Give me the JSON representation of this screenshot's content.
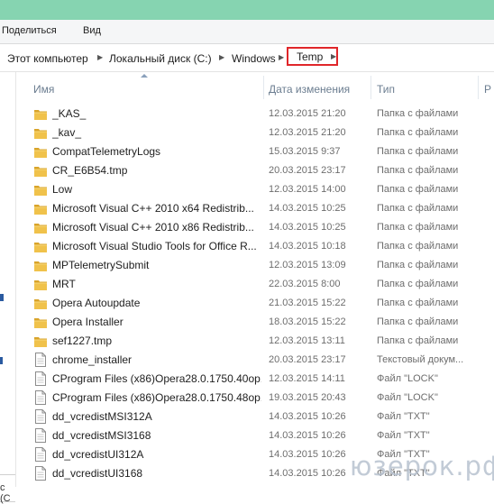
{
  "ribbon": {
    "tabs": [
      "Поделиться",
      "Вид"
    ]
  },
  "breadcrumb": [
    "Этот компьютер",
    "Локальный диск (C:)",
    "Windows",
    "Temp"
  ],
  "navigation_pane": {
    "partial_label": "с (C"
  },
  "columns": {
    "name": "Имя",
    "date": "Дата изменения",
    "type": "Тип",
    "size": "Р"
  },
  "files": [
    {
      "name": "_KAS_",
      "date": "12.03.2015 21:20",
      "type": "Папка с файлами",
      "kind": "folder"
    },
    {
      "name": "_kav_",
      "date": "12.03.2015 21:20",
      "type": "Папка с файлами",
      "kind": "folder"
    },
    {
      "name": "CompatTelemetryLogs",
      "date": "15.03.2015 9:37",
      "type": "Папка с файлами",
      "kind": "folder"
    },
    {
      "name": "CR_E6B54.tmp",
      "date": "20.03.2015 23:17",
      "type": "Папка с файлами",
      "kind": "folder"
    },
    {
      "name": "Low",
      "date": "12.03.2015 14:00",
      "type": "Папка с файлами",
      "kind": "folder"
    },
    {
      "name": "Microsoft Visual C++ 2010  x64 Redistrib...",
      "date": "14.03.2015 10:25",
      "type": "Папка с файлами",
      "kind": "folder"
    },
    {
      "name": "Microsoft Visual C++ 2010  x86 Redistrib...",
      "date": "14.03.2015 10:25",
      "type": "Папка с файлами",
      "kind": "folder"
    },
    {
      "name": "Microsoft Visual Studio Tools for Office R...",
      "date": "14.03.2015 10:18",
      "type": "Папка с файлами",
      "kind": "folder"
    },
    {
      "name": "MPTelemetrySubmit",
      "date": "12.03.2015 13:09",
      "type": "Папка с файлами",
      "kind": "folder"
    },
    {
      "name": "MRT",
      "date": "22.03.2015 8:00",
      "type": "Папка с файлами",
      "kind": "folder"
    },
    {
      "name": "Opera Autoupdate",
      "date": "21.03.2015 15:22",
      "type": "Папка с файлами",
      "kind": "folder"
    },
    {
      "name": "Opera Installer",
      "date": "18.03.2015 15:22",
      "type": "Папка с файлами",
      "kind": "folder"
    },
    {
      "name": "sef1227.tmp",
      "date": "12.03.2015 13:11",
      "type": "Папка с файлами",
      "kind": "folder"
    },
    {
      "name": "chrome_installer",
      "date": "20.03.2015 23:17",
      "type": "Текстовый докум...",
      "kind": "file"
    },
    {
      "name": "CProgram Files (x86)Opera28.0.1750.40op...",
      "date": "12.03.2015 14:11",
      "type": "Файл \"LOCK\"",
      "kind": "file"
    },
    {
      "name": "CProgram Files (x86)Opera28.0.1750.48op...",
      "date": "19.03.2015 20:43",
      "type": "Файл \"LOCK\"",
      "kind": "file"
    },
    {
      "name": "dd_vcredistMSI312A",
      "date": "14.03.2015 10:26",
      "type": "Файл \"TXT\"",
      "kind": "file"
    },
    {
      "name": "dd_vcredistMSI3168",
      "date": "14.03.2015 10:26",
      "type": "Файл \"TXT\"",
      "kind": "file"
    },
    {
      "name": "dd_vcredistUI312A",
      "date": "14.03.2015 10:26",
      "type": "Файл \"TXT\"",
      "kind": "file"
    },
    {
      "name": "dd_vcredistUI3168",
      "date": "14.03.2015 10:26",
      "type": "Файл \"TXT\"",
      "kind": "file"
    }
  ],
  "watermark": "юзерок.рф",
  "colors": {
    "title_bar": "#86d4b1",
    "highlight_border": "#e0262a",
    "folder": "#e8b83a"
  }
}
